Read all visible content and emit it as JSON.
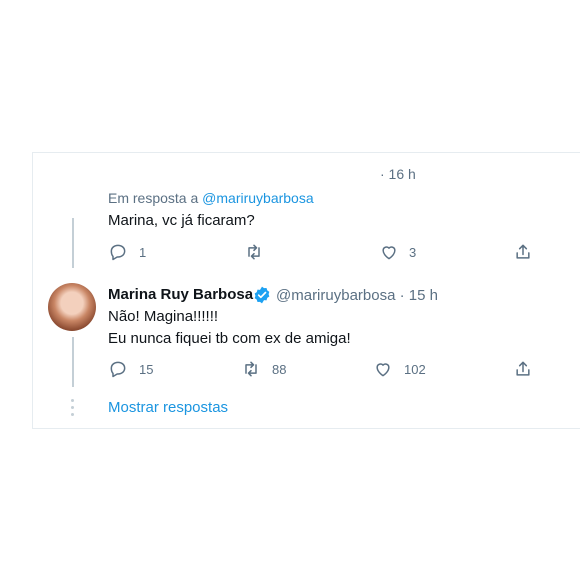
{
  "reply_tweet": {
    "time": "· 16 h",
    "in_reply_prefix": "Em resposta a",
    "in_reply_handle": "@mariruybarbosa",
    "text": "Marina, vc já ficaram?",
    "replies": "1",
    "retweets": "",
    "likes": "3"
  },
  "main_tweet": {
    "author_name": "Marina Ruy Barbosa",
    "handle_time": "@mariruybarbosa · 15 h",
    "verified": true,
    "text_line1": "Não! Magina!!!!!!",
    "text_line2": "Eu nunca fiquei tb com ex de amiga!",
    "replies": "15",
    "retweets": "88",
    "likes": "102"
  },
  "show_replies": "Mostrar respostas",
  "colors": {
    "link": "#1b95e0",
    "muted": "#5b7083",
    "verified": "#1da1f2",
    "divider": "#e6ecf0"
  },
  "icons": [
    "reply-icon",
    "retweet-icon",
    "like-icon",
    "share-icon",
    "verified-badge-icon"
  ]
}
